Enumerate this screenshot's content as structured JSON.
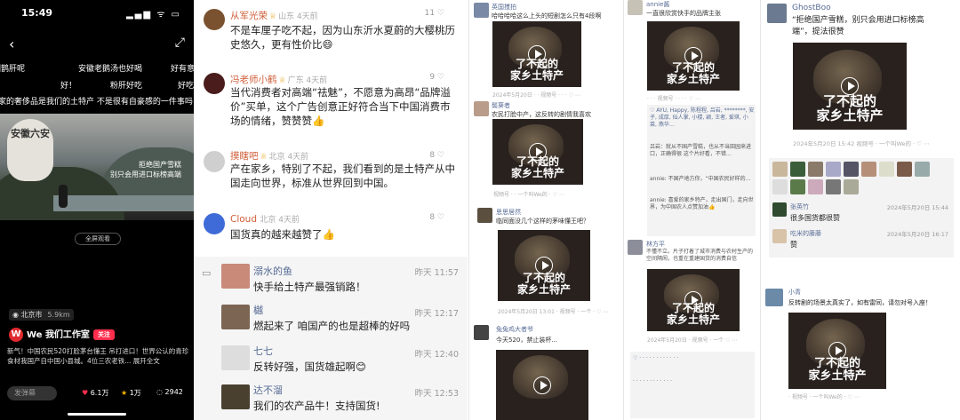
{
  "phone": {
    "time": "15:49",
    "danmu": [
      "圈鹊肝呢",
      "安徽老鹅汤也好喝",
      "好有意",
      "好！",
      "粉肝好吃",
      "好吃",
      "家的奢侈品是我们的土特产 不是很有自豪感的一件事吗"
    ],
    "balloon_text": "安徽六安",
    "overlay_lines": [
      "拒绝国产雪糕",
      "别只会用进口标榜高端"
    ],
    "fullscreen_label": "全屏观看",
    "location": "北京市",
    "distance": "5.9km",
    "account": "We 我们工作室",
    "follow": "关注",
    "caption": "新气！中国农民520打脸茅台懂王 吊打进口！世界公认的青珍食材我国产自中国小县城。4位三农老铁... 展开全文",
    "comment_placeholder": "发弹幕",
    "likes": "6.1万",
    "stars": "1万",
    "comments": "2942"
  },
  "weibo": [
    {
      "name": "从军光荣",
      "meta": "山东 4天前",
      "likes": "11",
      "text": "不是车厘子吃不起，因为山东沂水夏蔚的大樱桃历史悠久，更有性价比😄",
      "avatar_color": "#7a5230"
    },
    {
      "name": "冯老师小鹤",
      "meta": "广东 4天前",
      "likes": "9",
      "text": "当代消费者对高端“祛魅”，不愿意为高昂“品牌溢价”买单，这个广告创意正好符合当下中国消费市场的情绪，赞赞赞👍",
      "avatar_color": "#4a1c1c"
    },
    {
      "name": "摸瞎吧",
      "meta": "北京 4天前",
      "likes": "8",
      "text": "产在家乡，特别了不起，我们看到的是土特产从中国走向世界，标准从世界回到中国。",
      "avatar_color": "#cfcfcf"
    },
    {
      "name": "Cloud",
      "meta": "北京 4天前",
      "likes": "8",
      "text": "国货真的越来越赞了👍",
      "avatar_color": "#3f6bd8"
    }
  ],
  "wechat": [
    {
      "name": "溺水的鱼",
      "time": "昨天 11:57",
      "text": "快手给土特产最强销路！",
      "color": "#c98a7a"
    },
    {
      "name": "樾",
      "time": "昨天 12:17",
      "text": "燃起来了 咱国产的也是超棒的好吗",
      "color": "#7c6552"
    },
    {
      "name": "七七",
      "time": "昨天 12:40",
      "text": "反转好强，国货雄起啊😊",
      "color": "#ddd"
    },
    {
      "name": "达不溜",
      "time": "昨天 12:53",
      "text": "我们的农产品牛！支持国货!",
      "color": "#4a4030"
    }
  ],
  "video_title_line1": "了不起的",
  "video_title_line2": "家乡土特产",
  "gallery": {
    "c3": [
      {
        "name": "英国搅拍",
        "text": "哈哈哈哈这么上头的短剧怎么只有4段啊"
      },
      {
        "name": "鬓葵者",
        "text": "农民打脸中产，这反转的剧情我喜欢"
      },
      {
        "name": "思思居然",
        "text": "临同面没几个这样的茅味懂王吧？"
      },
      {
        "name": "兔兔鸡大者爷",
        "text": "今天520，禁止装杯..."
      }
    ],
    "c4": [
      {
        "name": "annie酱",
        "text": "一直很欣赏快手的品牌主张"
      },
      {
        "name": "林方平",
        "text": "不懂不立。片子打着了城市消费与农村生产的空间隔阂，也重在重建国货的消费自信"
      }
    ],
    "c5": [
      {
        "name": "GhostBoo",
        "text": "“拒绝国产雪糕，别只会用进口标榜高端”，提法很赞",
        "time": "2024年5月20日 15:42"
      },
      {
        "name": "张英竹",
        "text": "很多国货都很赞",
        "time": "2024年5月20日 15:44"
      },
      {
        "name": "吃米的藤藤",
        "text": "赞",
        "time": "2024年5月20日 16:17"
      },
      {
        "name": "小青",
        "text": "反转剧的场景太真实了，如有雷同，请勿对号入座！"
      }
    ]
  }
}
